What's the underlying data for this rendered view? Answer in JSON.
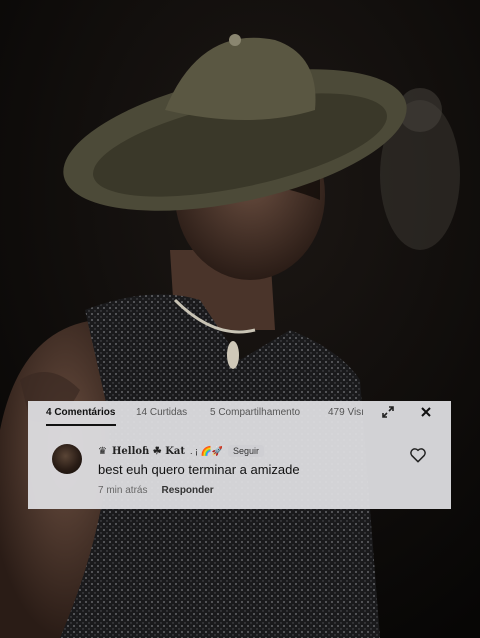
{
  "comments_panel": {
    "tabs": [
      {
        "label": "4 Comentários",
        "active": true
      },
      {
        "label": "14 Curtidas",
        "active": false
      },
      {
        "label": "5 Compartilhamento",
        "active": false
      },
      {
        "label": "479 Visı",
        "active": false
      }
    ],
    "comment": {
      "badge_icon": "crown-icon",
      "username": "Helloɦ ☘ Kat",
      "badges": ". ¡ 🌈🚀",
      "follow_label": "Seguir",
      "text": "best euh quero terminar a amizade",
      "time": "7 min atrás",
      "reply_label": "Responder"
    }
  },
  "colors": {
    "panel_bg": "#dddde0",
    "text_primary": "#111111",
    "text_secondary": "#666666",
    "background_photo": "#0b0908"
  }
}
